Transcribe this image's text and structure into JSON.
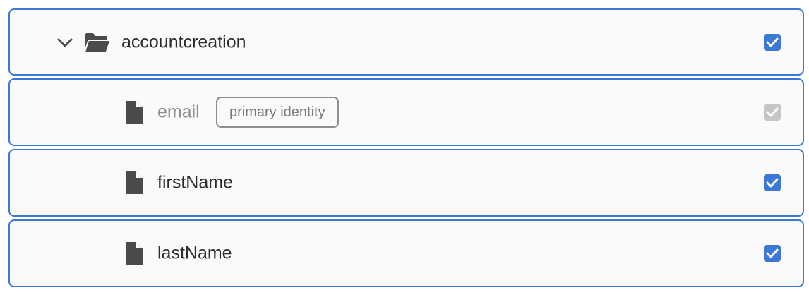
{
  "tree": {
    "folder": {
      "name": "accountcreation",
      "expanded": true,
      "checked": true,
      "icon": "folder-open-icon"
    },
    "fields": [
      {
        "name": "email",
        "badge": "primary identity",
        "checked": true,
        "disabled": true,
        "icon": "file-icon"
      },
      {
        "name": "firstName",
        "checked": true,
        "disabled": false,
        "icon": "file-icon"
      },
      {
        "name": "lastName",
        "checked": true,
        "disabled": false,
        "icon": "file-icon"
      }
    ]
  },
  "colors": {
    "accent": "#3b78d8",
    "disabled_check": "#c6c6c6",
    "row_background": "#fafafa",
    "text": "#2c2c2c",
    "muted_text": "#8e8e8e"
  }
}
